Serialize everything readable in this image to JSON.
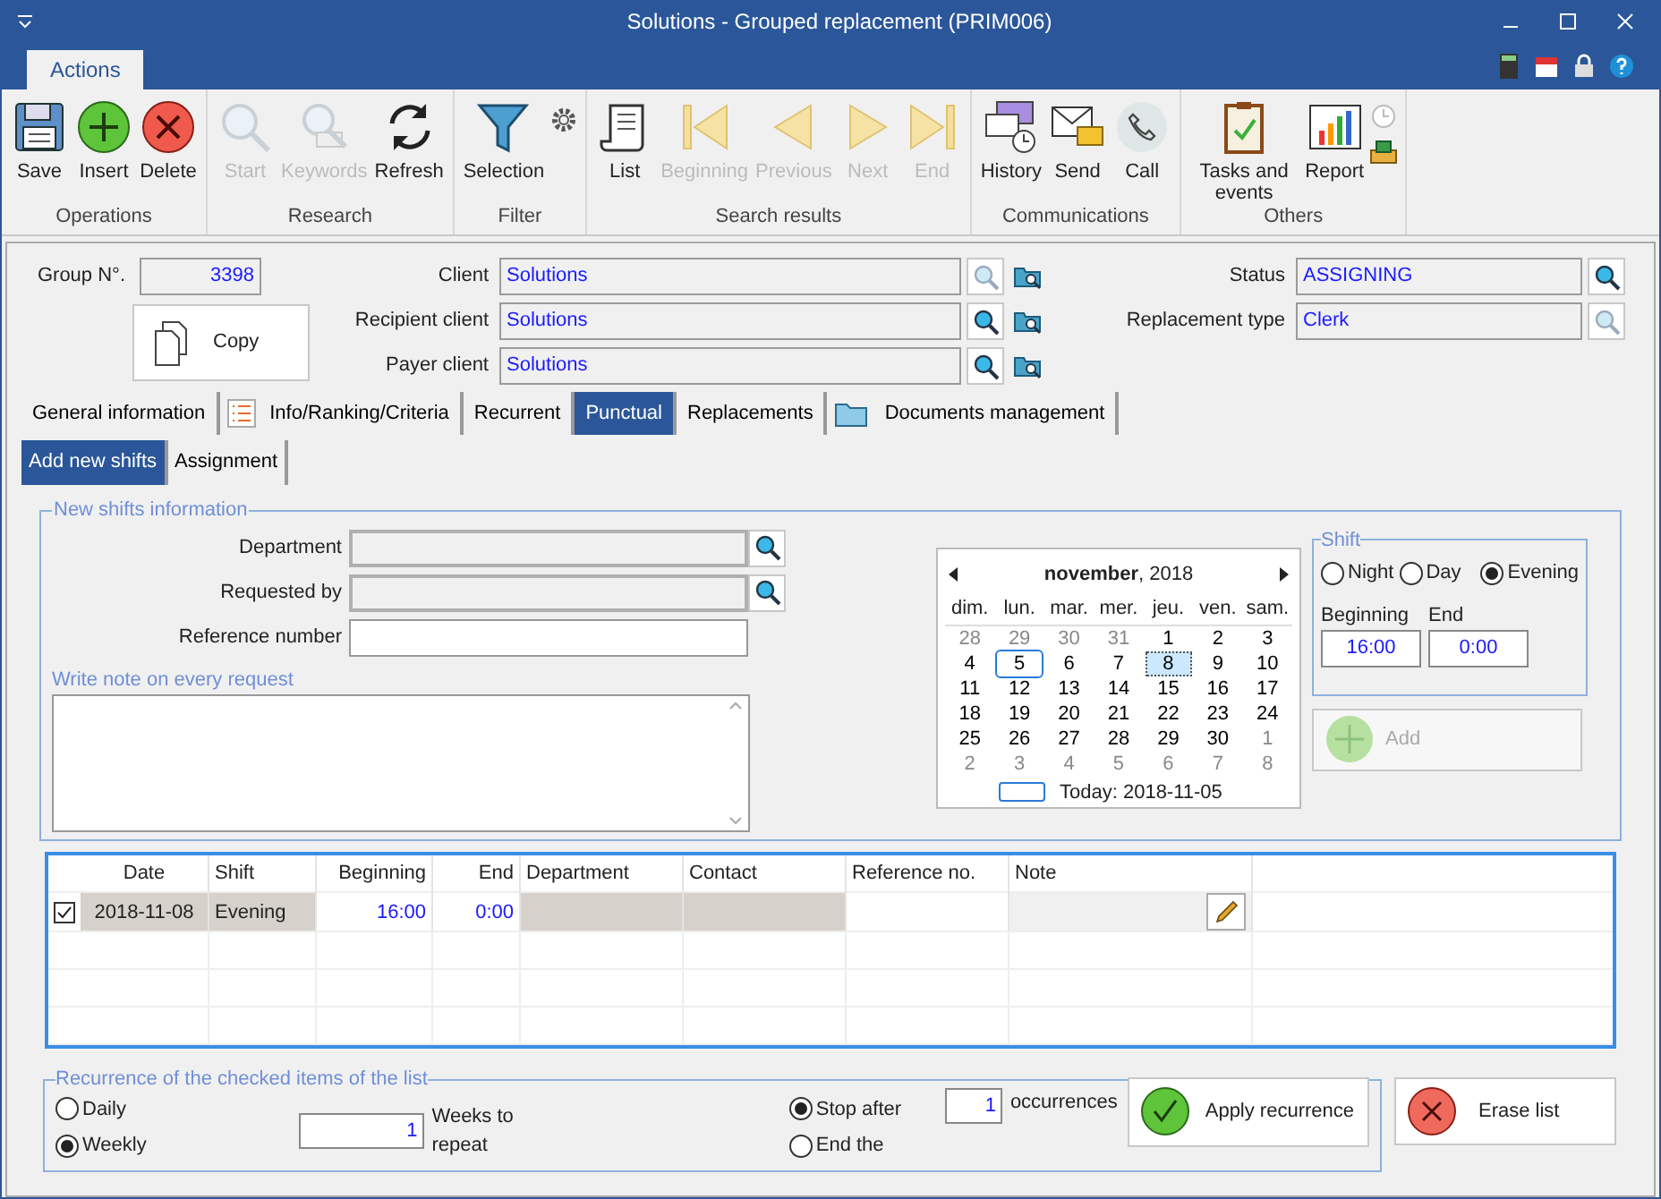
{
  "window": {
    "title": "Solutions - Grouped replacement (PRIM006)"
  },
  "ribbon": {
    "tabs": [
      {
        "label": "Actions",
        "selected": true
      }
    ],
    "groups": [
      {
        "label": "Operations",
        "buttons": [
          {
            "label": "Save",
            "disabled": false
          },
          {
            "label": "Insert",
            "disabled": false
          },
          {
            "label": "Delete",
            "disabled": false
          }
        ]
      },
      {
        "label": "Research",
        "buttons": [
          {
            "label": "Start",
            "disabled": true
          },
          {
            "label": "Keywords",
            "disabled": true
          },
          {
            "label": "Refresh",
            "disabled": false
          }
        ]
      },
      {
        "label": "Filter",
        "buttons": [
          {
            "label": "Selection",
            "disabled": false
          }
        ]
      },
      {
        "label": "Search results",
        "buttons": [
          {
            "label": "List",
            "disabled": false
          },
          {
            "label": "Beginning",
            "disabled": true
          },
          {
            "label": "Previous",
            "disabled": true
          },
          {
            "label": "Next",
            "disabled": true
          },
          {
            "label": "End",
            "disabled": true
          }
        ]
      },
      {
        "label": "Communications",
        "buttons": [
          {
            "label": "History",
            "disabled": false
          },
          {
            "label": "Send",
            "disabled": false
          },
          {
            "label": "Call",
            "disabled": false
          }
        ]
      },
      {
        "label": "Others",
        "buttons": [
          {
            "label": "Tasks and events",
            "disabled": false
          },
          {
            "label": "Report",
            "disabled": false
          }
        ]
      }
    ]
  },
  "header": {
    "group_number": {
      "label": "Group N°.",
      "value": "3398"
    },
    "copy_button": "Copy",
    "clients": [
      {
        "label": "Client",
        "value": "Solutions",
        "lookup_disabled": true
      },
      {
        "label": "Recipient client",
        "value": "Solutions",
        "lookup_disabled": false
      },
      {
        "label": "Payer client",
        "value": "Solutions",
        "lookup_disabled": false
      }
    ],
    "status": {
      "label": "Status",
      "value": "ASSIGNING",
      "lookup_disabled": false
    },
    "replacement_type": {
      "label": "Replacement type",
      "value": "Clerk",
      "lookup_disabled": true
    }
  },
  "tabs": [
    {
      "label": "General information",
      "selected": false
    },
    {
      "label": "Info/Ranking/Criteria",
      "selected": false
    },
    {
      "label": "Recurrent",
      "selected": false
    },
    {
      "label": "Punctual",
      "selected": true
    },
    {
      "label": "Replacements",
      "selected": false
    },
    {
      "label": "Documents management",
      "selected": false
    }
  ],
  "subtabs": [
    {
      "label": "Add new shifts",
      "selected": true
    },
    {
      "label": "Assignment",
      "selected": false
    }
  ],
  "new_shifts": {
    "title": "New shifts information",
    "fields": [
      {
        "label": "Department",
        "kind": "lookup"
      },
      {
        "label": "Requested by",
        "kind": "lookup"
      },
      {
        "label": "Reference number",
        "kind": "text"
      }
    ],
    "note_label": "Write note on every request"
  },
  "calendar": {
    "title": "**november**, 2018",
    "weekdays": [
      "dim.",
      "lun.",
      "mar.",
      "mer.",
      "jeu.",
      "ven.",
      "sam."
    ],
    "weeks": [
      [
        {
          "day": "28",
          "other_month": true,
          "selected": false,
          "today": false
        },
        {
          "day": "29",
          "other_month": true,
          "selected": false,
          "today": false
        },
        {
          "day": "30",
          "other_month": true,
          "selected": false,
          "today": false
        },
        {
          "day": "31",
          "other_month": true,
          "selected": false,
          "today": false
        },
        {
          "day": "1",
          "other_month": false,
          "selected": false,
          "today": false
        },
        {
          "day": "2",
          "other_month": false,
          "selected": false,
          "today": false
        },
        {
          "day": "3",
          "other_month": false,
          "selected": false,
          "today": false
        }
      ],
      [
        {
          "day": "4",
          "other_month": false,
          "selected": false,
          "today": false
        },
        {
          "day": "5",
          "other_month": false,
          "selected": false,
          "today": true
        },
        {
          "day": "6",
          "other_month": false,
          "selected": false,
          "today": false
        },
        {
          "day": "7",
          "other_month": false,
          "selected": false,
          "today": false
        },
        {
          "day": "8",
          "other_month": false,
          "selected": true,
          "today": false
        },
        {
          "day": "9",
          "other_month": false,
          "selected": false,
          "today": false
        },
        {
          "day": "10",
          "other_month": false,
          "selected": false,
          "today": false
        }
      ],
      [
        {
          "day": "11",
          "other_month": false,
          "selected": false,
          "today": false
        },
        {
          "day": "12",
          "other_month": false,
          "selected": false,
          "today": false
        },
        {
          "day": "13",
          "other_month": false,
          "selected": false,
          "today": false
        },
        {
          "day": "14",
          "other_month": false,
          "selected": false,
          "today": false
        },
        {
          "day": "15",
          "other_month": false,
          "selected": false,
          "today": false
        },
        {
          "day": "16",
          "other_month": false,
          "selected": false,
          "today": false
        },
        {
          "day": "17",
          "other_month": false,
          "selected": false,
          "today": false
        }
      ],
      [
        {
          "day": "18",
          "other_month": false,
          "selected": false,
          "today": false
        },
        {
          "day": "19",
          "other_month": false,
          "selected": false,
          "today": false
        },
        {
          "day": "20",
          "other_month": false,
          "selected": false,
          "today": false
        },
        {
          "day": "21",
          "other_month": false,
          "selected": false,
          "today": false
        },
        {
          "day": "22",
          "other_month": false,
          "selected": false,
          "today": false
        },
        {
          "day": "23",
          "other_month": false,
          "selected": false,
          "today": false
        },
        {
          "day": "24",
          "other_month": false,
          "selected": false,
          "today": false
        }
      ],
      [
        {
          "day": "25",
          "other_month": false,
          "selected": false,
          "today": false
        },
        {
          "day": "26",
          "other_month": false,
          "selected": false,
          "today": false
        },
        {
          "day": "27",
          "other_month": false,
          "selected": false,
          "today": false
        },
        {
          "day": "28",
          "other_month": false,
          "selected": false,
          "today": false
        },
        {
          "day": "29",
          "other_month": false,
          "selected": false,
          "today": false
        },
        {
          "day": "30",
          "other_month": false,
          "selected": false,
          "today": false
        },
        {
          "day": "1",
          "other_month": true,
          "selected": false,
          "today": false
        }
      ],
      [
        {
          "day": "2",
          "other_month": true,
          "selected": false,
          "today": false
        },
        {
          "day": "3",
          "other_month": true,
          "selected": false,
          "today": false
        },
        {
          "day": "4",
          "other_month": true,
          "selected": false,
          "today": false
        },
        {
          "day": "5",
          "other_month": true,
          "selected": false,
          "today": false
        },
        {
          "day": "6",
          "other_month": true,
          "selected": false,
          "today": false
        },
        {
          "day": "7",
          "other_month": true,
          "selected": false,
          "today": false
        },
        {
          "day": "8",
          "other_month": true,
          "selected": false,
          "today": false
        }
      ]
    ],
    "today_label": "Today: 2018-11-05"
  },
  "shift": {
    "title": "Shift",
    "options": [
      {
        "label": "Night",
        "selected": false
      },
      {
        "label": "Day",
        "selected": false
      },
      {
        "label": "Evening",
        "selected": true
      }
    ],
    "beginning_label": "Beginning",
    "beginning": "16:00",
    "end_label": "End",
    "end": "0:00"
  },
  "add_button": {
    "label": "Add",
    "disabled": true
  },
  "table": {
    "columns": [
      "Date",
      "Shift",
      "Beginning",
      "End",
      "Department",
      "Contact",
      "Reference no.",
      "Note"
    ],
    "rows": [
      {
        "checked": true,
        "date": "2018-11-08",
        "shift": "Evening",
        "beginning": "16:00",
        "end": "0:00"
      }
    ]
  },
  "recurrence": {
    "title": "Recurrence of the checked items of the list",
    "frequency": [
      {
        "label": "Daily",
        "selected": false
      },
      {
        "label": "Weekly",
        "selected": true
      }
    ],
    "weeks": "1",
    "weeks_label": "Weeks to repeat",
    "stop": [
      {
        "label": "Stop after",
        "selected": true
      },
      {
        "label": "End the",
        "selected": false
      }
    ],
    "occurrences": "1",
    "occurrences_label": "occurrences",
    "apply_button": "Apply recurrence",
    "erase_button": "Erase list"
  }
}
